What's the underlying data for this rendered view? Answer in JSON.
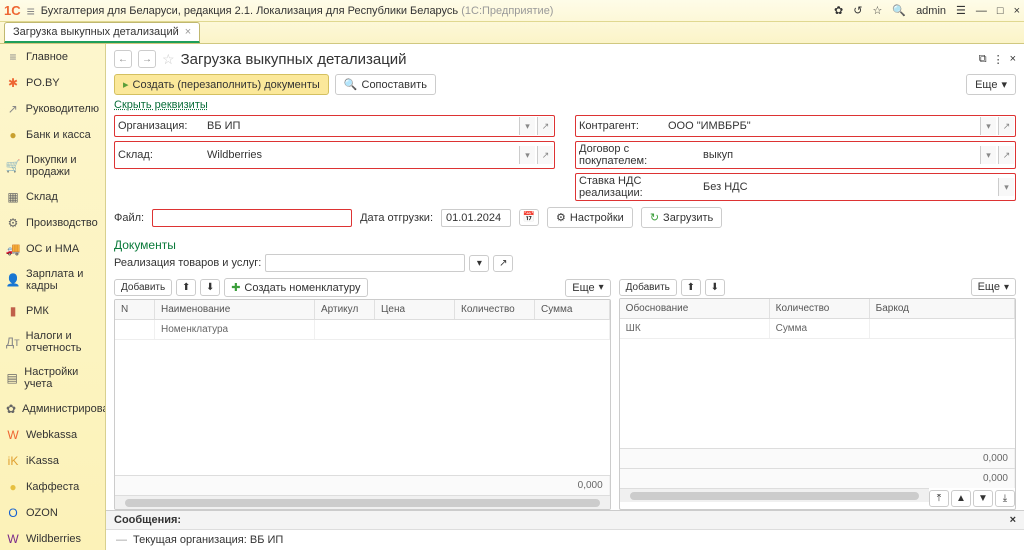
{
  "app": {
    "logo": "1C",
    "title": "Бухгалтерия для Беларуси, редакция 2.1. Локализация для Республики Беларусь",
    "suffix": "(1С:Предприятие)",
    "user": "admin"
  },
  "tab": {
    "label": "Загрузка выкупных детализаций"
  },
  "sidebar": [
    {
      "icon": "≡",
      "label": "Главное",
      "color": "#888"
    },
    {
      "icon": "✱",
      "label": "PO.BY",
      "color": "#e63"
    },
    {
      "icon": "↗",
      "label": "Руководителю",
      "color": "#888"
    },
    {
      "icon": "●",
      "label": "Банк и касса",
      "color": "#c8a030"
    },
    {
      "icon": "🛒",
      "label": "Покупки и продажи",
      "color": "#666"
    },
    {
      "icon": "▦",
      "label": "Склад",
      "color": "#666"
    },
    {
      "icon": "⚙",
      "label": "Производство",
      "color": "#666"
    },
    {
      "icon": "🚚",
      "label": "ОС и НМА",
      "color": "#666"
    },
    {
      "icon": "👤",
      "label": "Зарплата и кадры",
      "color": "#c0604a"
    },
    {
      "icon": "▮",
      "label": "РМК",
      "color": "#c0604a"
    },
    {
      "icon": "Дт",
      "label": "Налоги и отчетность",
      "color": "#888"
    },
    {
      "icon": "▤",
      "label": "Настройки учета",
      "color": "#666"
    },
    {
      "icon": "✿",
      "label": "Администрирование",
      "color": "#666"
    },
    {
      "icon": "W",
      "label": "Webkassa",
      "color": "#e63"
    },
    {
      "icon": "iK",
      "label": "iKassa",
      "color": "#e0a030"
    },
    {
      "icon": "●",
      "label": "Каффеста",
      "color": "#e6c040"
    },
    {
      "icon": "O",
      "label": "OZON",
      "color": "#1560d0"
    },
    {
      "icon": "W",
      "label": "Wildberries",
      "color": "#7a2a8a"
    }
  ],
  "page": {
    "title": "Загрузка выкупных детализаций",
    "create_btn": "Создать (перезаполнить) документы",
    "compare_btn": "Сопоставить",
    "more_btn": "Еще",
    "hide_link": "Скрыть реквизиты"
  },
  "fields": {
    "org_lbl": "Организация:",
    "org_val": "ВБ ИП",
    "sklad_lbl": "Склад:",
    "sklad_val": "Wildberries",
    "contr_lbl": "Контрагент:",
    "contr_val": "ООО \"ИМВБРБ\"",
    "dog_lbl": "Договор с покупателем:",
    "dog_val": "выкуп",
    "nds_lbl": "Ставка НДС реализации:",
    "nds_val": "Без НДС",
    "file_lbl": "Файл:",
    "date_lbl": "Дата отгрузки:",
    "date_val": "01.01.2024",
    "settings_btn": "Настройки",
    "load_btn": "Загрузить"
  },
  "docs": {
    "title": "Документы",
    "combo_lbl": "Реализация товаров и услуг:"
  },
  "leftPanel": {
    "add": "Добавить",
    "create_nom": "Создать номенклатуру",
    "more": "Еще",
    "cols": {
      "n": "N",
      "name": "Наименование",
      "art": "Артикул",
      "price": "Цена",
      "qty": "Количество",
      "sum": "Сумма"
    },
    "row2_name": "Номенклатура",
    "total": "0,000"
  },
  "rightPanel": {
    "add": "Добавить",
    "more": "Еще",
    "cols": {
      "osn": "Обоснование",
      "qty": "Количество",
      "bar": "Баркод"
    },
    "row2": {
      "shk": "ШК",
      "sum": "Сумма"
    },
    "total1": "0,000",
    "total2": "0,000"
  },
  "messages": {
    "title": "Сообщения:",
    "msg": "Текущая организация: ВБ ИП"
  }
}
